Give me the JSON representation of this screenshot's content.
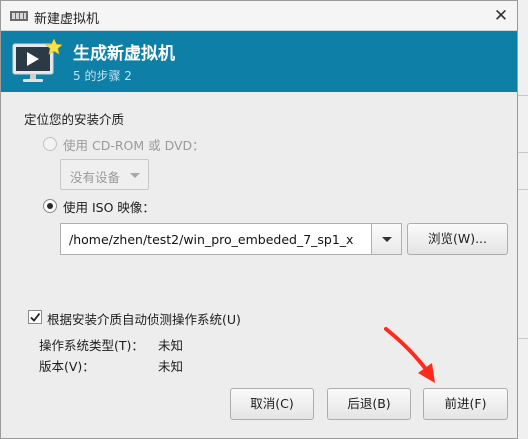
{
  "window": {
    "title": "新建虚拟机"
  },
  "banner": {
    "title": "生成新虚拟机",
    "step": "5 的步骤 2"
  },
  "install_media": {
    "section_title": "定位您的安装介质",
    "cdrom_option": {
      "label": "使用 CD-ROM 或 DVD：",
      "selected": false,
      "enabled": false,
      "device_select": {
        "value": "没有设备"
      }
    },
    "iso_option": {
      "label": "使用 ISO 映像：",
      "selected": true,
      "path_value": "/home/zhen/test2/win_pro_embeded_7_sp1_x",
      "browse_label": "浏览(W)..."
    }
  },
  "os_detect": {
    "checkbox_label": "根据安装介质自动侦测操作系统(U)",
    "checked": true,
    "os_type_label": "操作系统类型(T)：",
    "os_type_value": "未知",
    "version_label": "版本(V)：",
    "version_value": "未知"
  },
  "footer": {
    "cancel_label": "取消(C)",
    "back_label": "后退(B)",
    "forward_label": "前进(F)"
  },
  "colors": {
    "banner_bg": "#0e7fa6",
    "annotation_arrow": "#ff2a1a"
  }
}
